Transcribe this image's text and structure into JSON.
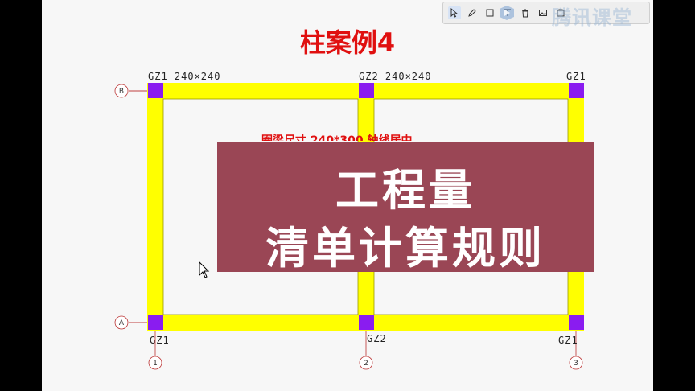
{
  "slide": {
    "title": "柱案例4",
    "beam_note": "圈梁尺寸  240*300  轴线居中",
    "banner": {
      "line1": "工程量",
      "line2": "清单计算规则"
    },
    "watermark": "腾讯课堂",
    "column_labels": {
      "top_left": "GZ1  240×240",
      "top_mid": "GZ2  240×240",
      "top_right": "GZ1",
      "bottom_left": "GZ1",
      "bottom_mid": "GZ2",
      "bottom_right": "GZ1"
    },
    "axes": {
      "row_b": "B",
      "row_a": "A",
      "col_1": "1",
      "col_2": "2",
      "col_3": "3"
    }
  },
  "colors": {
    "beam": "#ffff00",
    "column": "#8a1cf0",
    "title": "#e01010",
    "banner": "#9a4655"
  },
  "toolbar": {
    "icons": [
      "cursor-select-icon",
      "pen-icon",
      "rectangle-icon",
      "text-icon",
      "delete-icon",
      "image-icon",
      "snapshot-icon"
    ]
  }
}
